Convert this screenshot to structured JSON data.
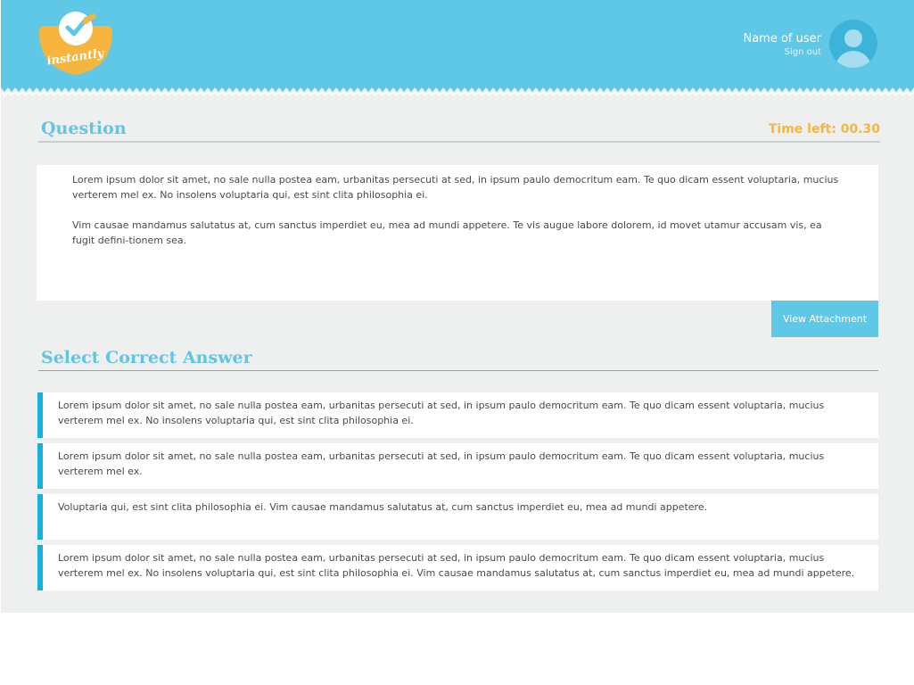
{
  "header": {
    "logo_text": "instantly",
    "user_name": "Name of user",
    "sign_out": "Sign out"
  },
  "question": {
    "title": "Question",
    "timer": "Time left: 00.30",
    "paragraphs": [
      "Lorem ipsum dolor sit amet, no sale nulla postea eam, urbanitas persecuti at sed, in ipsum paulo democritum eam. Te quo dicam essent voluptaria, mucius verterem mel ex. No insolens voluptaria qui, est sint clita philosophia ei.",
      "Vim causae mandamus salutatus at, cum sanctus imperdiet eu, mea ad mundi appetere. Te vis augue labore dolorem, id movet utamur accusam vis, ea fugit defini-tionem sea."
    ],
    "attachment_button": "View Attachment"
  },
  "answers": {
    "title": "Select Correct Answer",
    "options": [
      "Lorem ipsum dolor sit amet, no sale nulla postea eam, urbanitas persecuti at sed, in ipsum paulo democritum eam. Te quo dicam essent voluptaria, mucius verterem mel ex. No insolens voluptaria qui, est sint clita philosophia ei.",
      "Lorem ipsum dolor sit amet, no sale nulla postea eam, urbanitas persecuti at sed, in ipsum paulo democritum eam. Te quo dicam essent voluptaria, mucius verterem mel ex.",
      "Voluptaria qui, est sint clita philosophia ei. Vim causae mandamus salutatus at, cum sanctus imperdiet eu, mea ad mundi appetere.",
      "Lorem ipsum dolor sit amet, no sale nulla postea eam, urbanitas persecuti at sed, in ipsum paulo democritum eam. Te quo dicam essent voluptaria, mucius verterem mel ex. No insolens voluptaria qui, est sint clita philosophia ei. Vim causae mandamus salutatus at, cum sanctus imperdiet eu, mea ad mundi appetere."
    ]
  },
  "colors": {
    "header_blue": "#5fc8e6",
    "accent_orange": "#f5b53f",
    "answer_bar": "#17b0db",
    "background": "#eeefef"
  },
  "icons": [
    "instantly-logo",
    "user-avatar-icon"
  ]
}
